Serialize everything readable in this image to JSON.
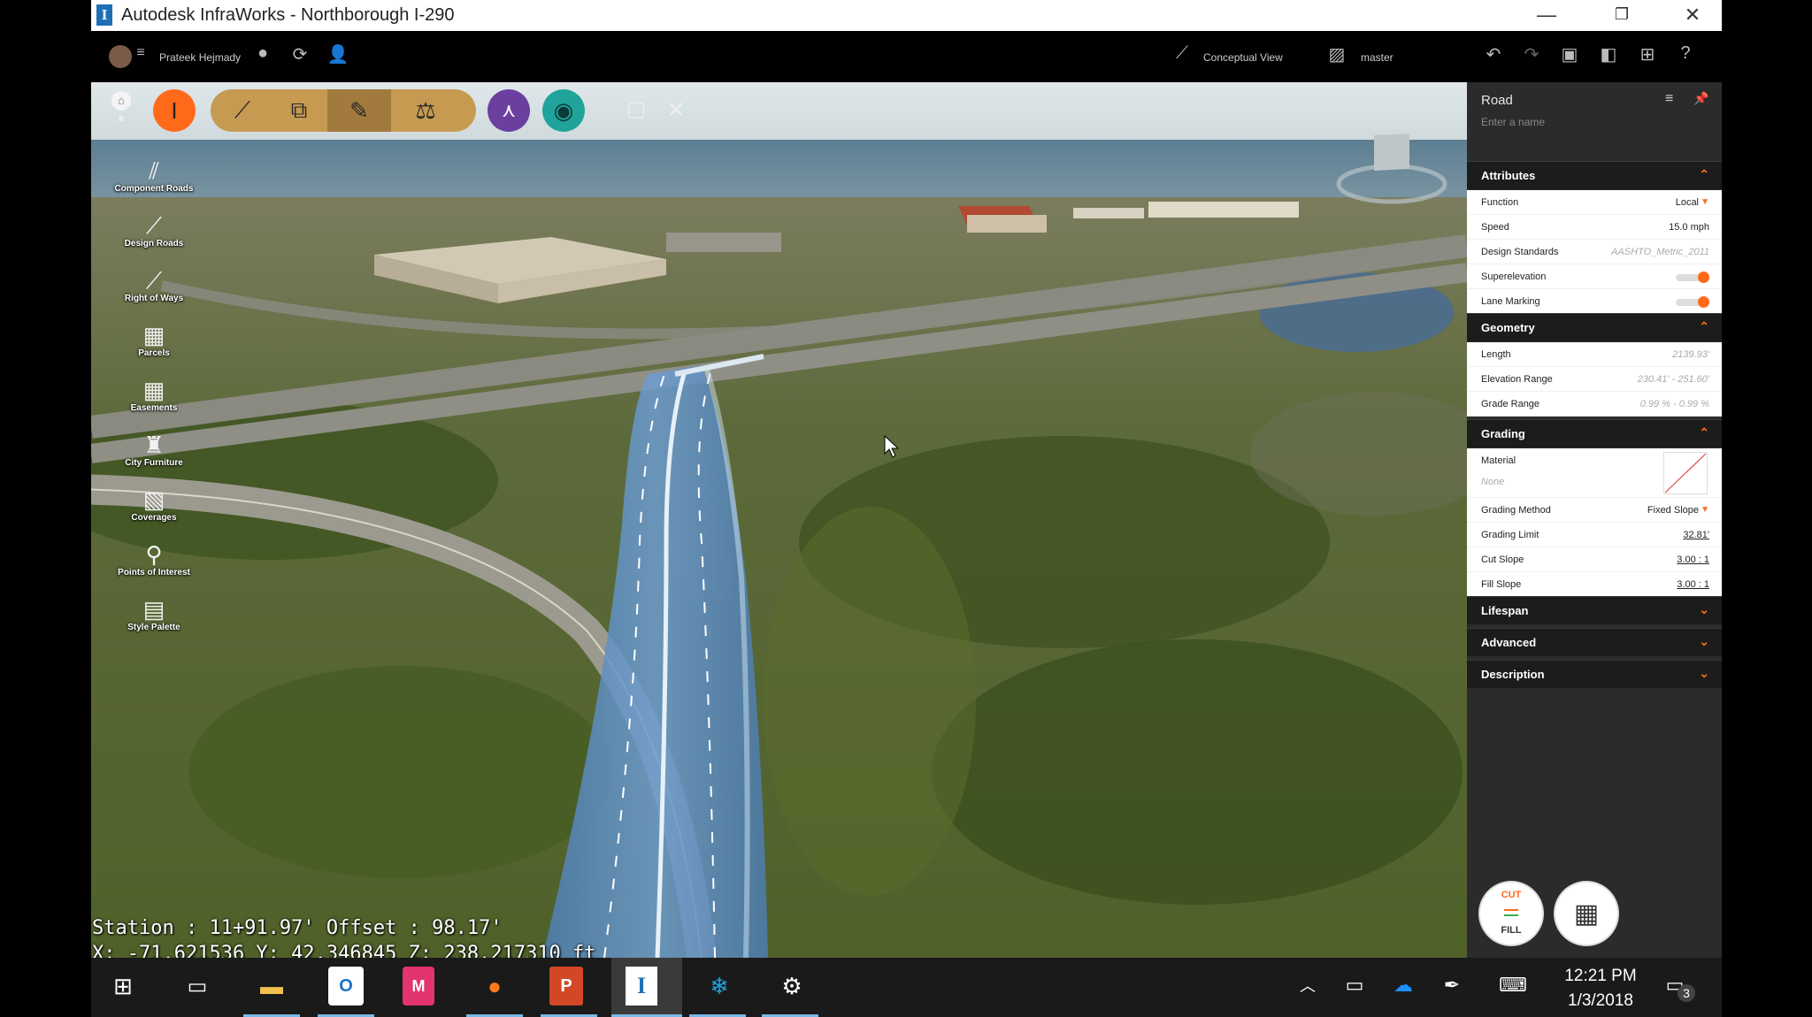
{
  "window": {
    "title": "Autodesk InfraWorks - Northborough I-290",
    "minimize": "—",
    "restore": "❐",
    "close": "✕"
  },
  "header": {
    "user_name": "Prateek Hejmady",
    "view_mode": "Conceptual View",
    "branch": "master"
  },
  "left_tools": [
    {
      "label": "Component Roads",
      "icon": "component-roads-icon",
      "glyph": "⫽"
    },
    {
      "label": "Design Roads",
      "icon": "design-roads-icon",
      "glyph": "⟋"
    },
    {
      "label": "Right of Ways",
      "icon": "right-of-ways-icon",
      "glyph": "⟋"
    },
    {
      "label": "Parcels",
      "icon": "parcels-icon",
      "glyph": "▦"
    },
    {
      "label": "Easements",
      "icon": "easements-icon",
      "glyph": "▦"
    },
    {
      "label": "City Furniture",
      "icon": "city-furniture-icon",
      "glyph": "♜"
    },
    {
      "label": "Coverages",
      "icon": "coverages-icon",
      "glyph": "▧"
    },
    {
      "label": "Points of Interest",
      "icon": "points-of-interest-icon",
      "glyph": "⚲"
    },
    {
      "label": "Style Palette",
      "icon": "style-palette-icon",
      "glyph": "▤"
    }
  ],
  "viewport": {
    "station_line": "Station : 11+91.97' Offset : 98.17'",
    "coord_line": "X: -71.621536 Y: 42.346845 Z: 238.217310 ft"
  },
  "panel": {
    "title": "Road",
    "name_placeholder": "Enter a name",
    "attributes": {
      "header": "Attributes",
      "rows": [
        {
          "label": "Function",
          "value": "Local"
        },
        {
          "label": "Speed",
          "value": "15.0 mph"
        },
        {
          "label": "Design Standards",
          "value": "AASHTO_Metric_2011"
        },
        {
          "label": "Superelevation",
          "value": "on"
        },
        {
          "label": "Lane Marking",
          "value": "on"
        }
      ]
    },
    "geometry": {
      "header": "Geometry",
      "rows": [
        {
          "label": "Length",
          "value": "2139.93'"
        },
        {
          "label": "Elevation Range",
          "value": "230.41' - 251.60'"
        },
        {
          "label": "Grade Range",
          "value": "0.99 % - 0.99 %"
        }
      ]
    },
    "grading": {
      "header": "Grading",
      "material_label": "Material",
      "material_value": "None",
      "rows": [
        {
          "label": "Grading Method",
          "value": "Fixed Slope"
        },
        {
          "label": "Grading Limit",
          "value": "32.81'"
        },
        {
          "label": "Cut Slope",
          "value": "3.00 : 1"
        },
        {
          "label": "Fill Slope",
          "value": "3.00 : 1"
        }
      ]
    },
    "collapsed_sections": [
      "Lifespan",
      "Advanced",
      "Description"
    ],
    "cut_label": "CUT",
    "fill_label": "FILL"
  },
  "taskbar": {
    "time": "12:21 PM",
    "date": "1/3/2018",
    "notifications": "3"
  },
  "colors": {
    "accent": "#ff6a1a",
    "road_blue": "#5a8fc4",
    "toolbar_tan": "#c79a52",
    "purple": "#6b3fa0",
    "teal": "#1fa39a"
  }
}
